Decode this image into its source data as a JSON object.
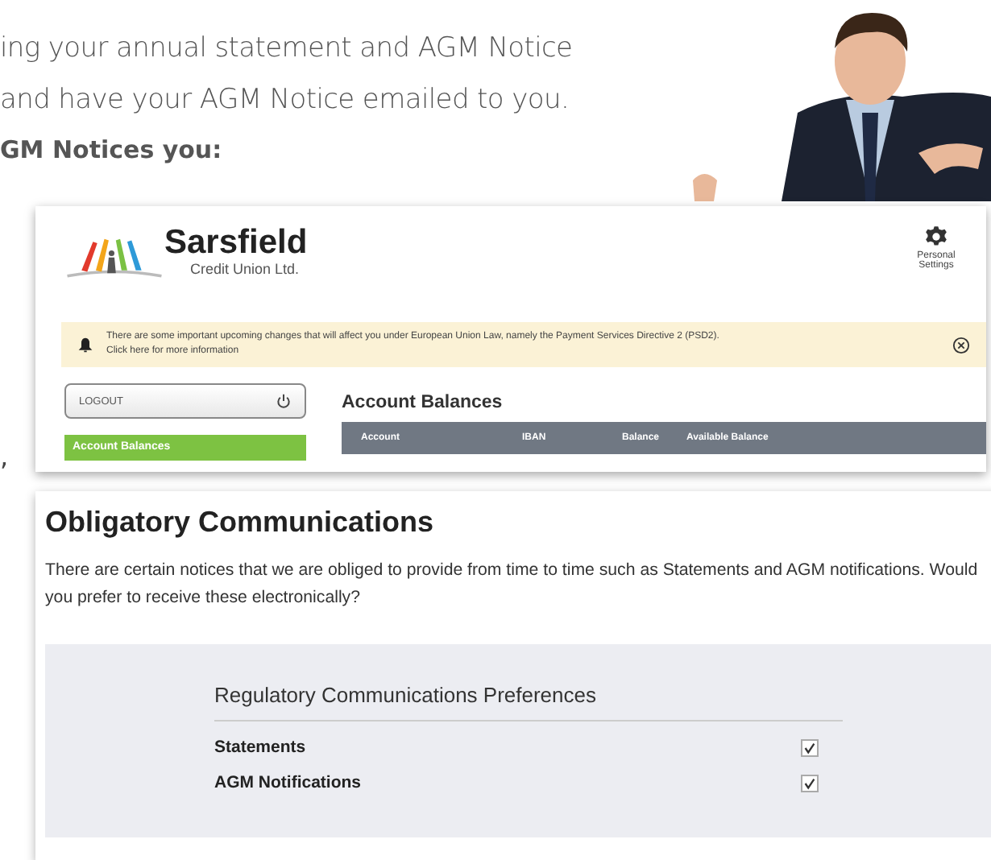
{
  "intro": {
    "lines": [
      "ing your annual statement and AGM Notice",
      "and have your AGM Notice emailed to you."
    ],
    "subheading": "GM Notices you:",
    "fragment": ","
  },
  "portal": {
    "brand": {
      "name": "Sarsfield",
      "tagline": "Credit Union Ltd."
    },
    "settings_label": "Personal Settings",
    "notice": {
      "text": "There are some important upcoming changes that will affect you under European Union Law, namely the Payment Services Directive 2 (PSD2).",
      "link": "Click here for more information"
    },
    "logout": "LOGOUT",
    "nav_items": [
      {
        "label": "Account Balances",
        "selected": true
      }
    ],
    "heading": "Account Balances",
    "columns": [
      "Account",
      "IBAN",
      "Balance",
      "Available Balance"
    ]
  },
  "communications": {
    "title": "Obligatory Communications",
    "description": "There are certain notices that we are obliged to provide from time to time such as Statements and AGM notifications. Would you prefer to receive these electronically?",
    "preferences": {
      "title": "Regulatory Communications Preferences",
      "items": [
        {
          "label": "Statements",
          "checked": true
        },
        {
          "label": "AGM Notifications",
          "checked": true
        }
      ]
    }
  }
}
